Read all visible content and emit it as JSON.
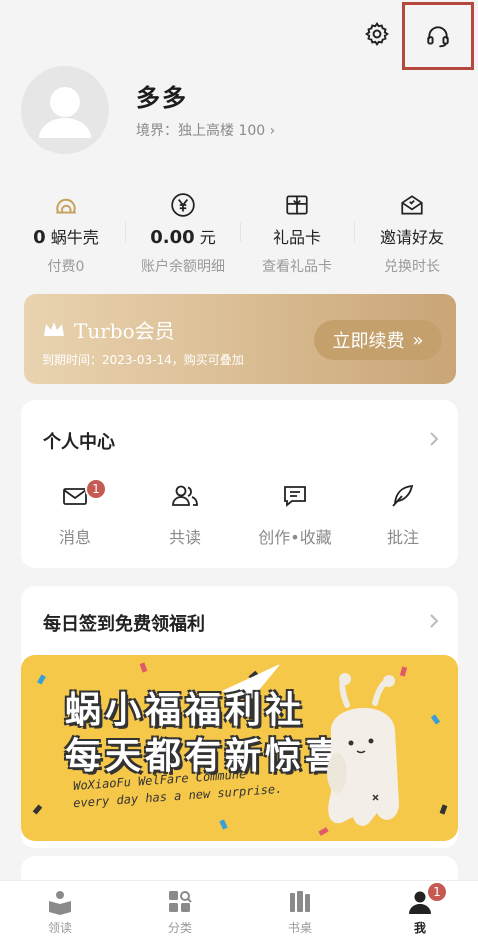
{
  "user": {
    "name": "多多",
    "rank": "境界：独上高楼 100"
  },
  "stats": [
    {
      "value": "0",
      "unit": "蜗牛壳",
      "sub": "付费0",
      "icon": "snail-shell-icon"
    },
    {
      "value": "0.00",
      "unit": "元",
      "sub": "账户余额明细",
      "icon": "yen-icon"
    },
    {
      "value": "",
      "unit": "礼品卡",
      "sub": "查看礼品卡",
      "icon": "gift-card-icon"
    },
    {
      "value": "",
      "unit": "邀请好友",
      "sub": "兑换时长",
      "icon": "invite-envelope-icon"
    }
  ],
  "vip": {
    "title": "Turbo会员",
    "expiry": "到期时间：2023-03-14，购买可叠加",
    "renew_label": "立即续费"
  },
  "personal": {
    "title": "个人中心",
    "items": [
      {
        "label": "消息",
        "icon": "mail-icon",
        "badge": "1"
      },
      {
        "label": "共读",
        "icon": "people-icon"
      },
      {
        "label": "创作•收藏",
        "icon": "chat-lines-icon"
      },
      {
        "label": "批注",
        "icon": "feather-icon"
      }
    ]
  },
  "checkin": {
    "title": "每日签到免费领福利",
    "banner_line1": "蜗小福福利社",
    "banner_line2": "每天都有新惊喜",
    "banner_en1": "WoXiaoFu WelFare Commune",
    "banner_en2": "every day has a new surprise."
  },
  "tabs": [
    {
      "label": "领读",
      "icon": "book-reader-icon"
    },
    {
      "label": "分类",
      "icon": "category-search-icon"
    },
    {
      "label": "书桌",
      "icon": "bookshelf-icon"
    },
    {
      "label": "我",
      "icon": "user-icon",
      "badge": "1",
      "active": true
    }
  ],
  "colors": {
    "accent_gold": "#c4a06d",
    "badge_red": "#c45a52",
    "banner_yellow": "#f5c84a",
    "highlight_border": "#b5483f"
  }
}
